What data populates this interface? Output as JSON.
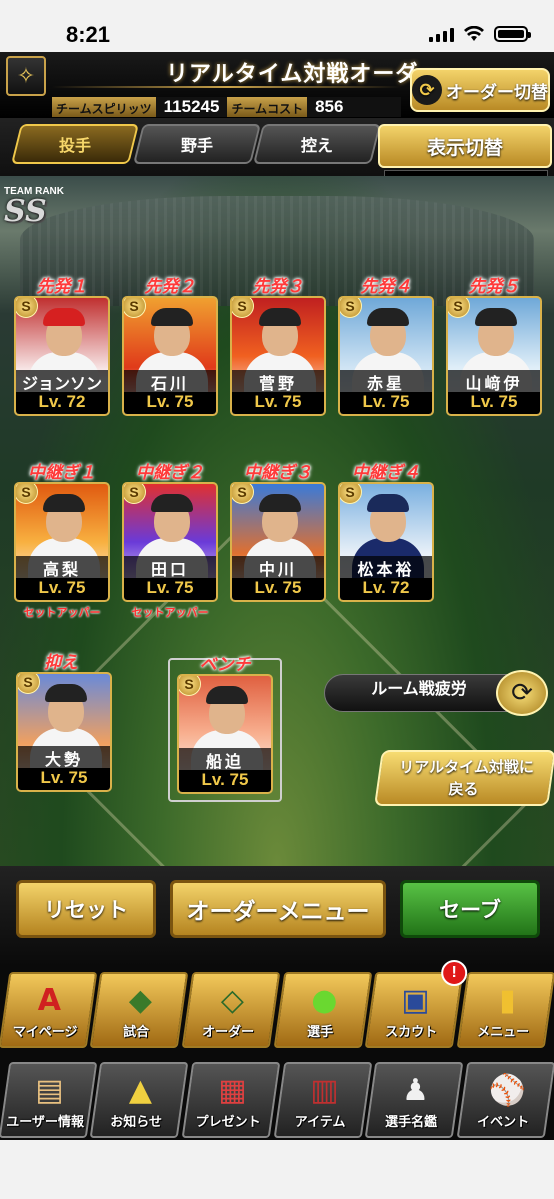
{
  "status_bar": {
    "time": "8:21"
  },
  "header": {
    "title": "リアルタイム対戦オーダー",
    "team_spirits_label": "チームスピリッツ",
    "team_spirits_value": "115245",
    "team_cost_label": "チームコスト",
    "team_cost_value": "856",
    "order_switch_label": "オーダー切替"
  },
  "tabs": [
    {
      "label": "投手",
      "active": true
    },
    {
      "label": "野手",
      "active": false
    },
    {
      "label": "控え",
      "active": false
    }
  ],
  "display_switch": {
    "label": "表示切替",
    "value": "ー"
  },
  "team_rank": {
    "label": "TEAM RANK",
    "value": "SS"
  },
  "starters": [
    {
      "position": "先発１",
      "name": "ジョンソン",
      "level": "Lv. 72",
      "badge": "S",
      "cap_color": "#d62020"
    },
    {
      "position": "先発２",
      "name": "石川",
      "level": "Lv. 75",
      "badge": "S",
      "cap_color": "#222222"
    },
    {
      "position": "先発３",
      "name": "菅野",
      "level": "Lv. 75",
      "badge": "S",
      "cap_color": "#222222"
    },
    {
      "position": "先発４",
      "name": "赤星",
      "level": "Lv. 75",
      "badge": "S",
      "cap_color": "#222222"
    },
    {
      "position": "先発５",
      "name": "山﨑伊",
      "level": "Lv. 75",
      "badge": "S",
      "cap_color": "#222222"
    }
  ],
  "relievers": [
    {
      "position": "中継ぎ１",
      "name": "高梨",
      "level": "Lv. 75",
      "badge": "S",
      "role": "セットアッパー",
      "cap_color": "#222222"
    },
    {
      "position": "中継ぎ２",
      "name": "田口",
      "level": "Lv. 75",
      "badge": "S",
      "role": "セットアッパー",
      "cap_color": "#222222"
    },
    {
      "position": "中継ぎ３",
      "name": "中川",
      "level": "Lv. 75",
      "badge": "S",
      "role": "",
      "cap_color": "#222222"
    },
    {
      "position": "中継ぎ４",
      "name": "松本裕",
      "level": "Lv. 72",
      "badge": "S",
      "role": "",
      "cap_color": "#1a2a5a"
    }
  ],
  "closer": {
    "position": "抑え",
    "name": "大勢",
    "level": "Lv. 75",
    "badge": "S"
  },
  "bench": {
    "position": "ベンチ",
    "name": "船迫",
    "level": "Lv. 75",
    "badge": "S"
  },
  "room_fatigue": {
    "label": "ルーム戦疲労"
  },
  "back_button": {
    "line1": "リアルタイム対戦に",
    "line2": "戻る"
  },
  "actions": {
    "reset": "リセット",
    "order_menu": "オーダーメニュー",
    "save": "セーブ"
  },
  "nav_primary": [
    {
      "label": "マイページ",
      "icon": "mypage-icon",
      "glyph": "A"
    },
    {
      "label": "試合",
      "icon": "stadium-icon",
      "glyph": "◆"
    },
    {
      "label": "オーダー",
      "icon": "diamond-icon",
      "glyph": "◇"
    },
    {
      "label": "選手",
      "icon": "player-icon",
      "glyph": "●"
    },
    {
      "label": "スカウト",
      "icon": "scout-icon",
      "glyph": "▣",
      "alert": "!"
    },
    {
      "label": "メニュー",
      "icon": "menu-icon",
      "glyph": "▮"
    }
  ],
  "nav_secondary": [
    {
      "label": "ユーザー情報",
      "icon": "user-info-icon",
      "glyph": "▤"
    },
    {
      "label": "お知らせ",
      "icon": "notice-icon",
      "glyph": "▲"
    },
    {
      "label": "プレゼント",
      "icon": "gift-icon",
      "glyph": "▦"
    },
    {
      "label": "アイテム",
      "icon": "item-icon",
      "glyph": "▥"
    },
    {
      "label": "選手名鑑",
      "icon": "player-directory-icon",
      "glyph": "♟"
    },
    {
      "label": "イベント",
      "icon": "event-icon",
      "glyph": "⚾"
    }
  ]
}
